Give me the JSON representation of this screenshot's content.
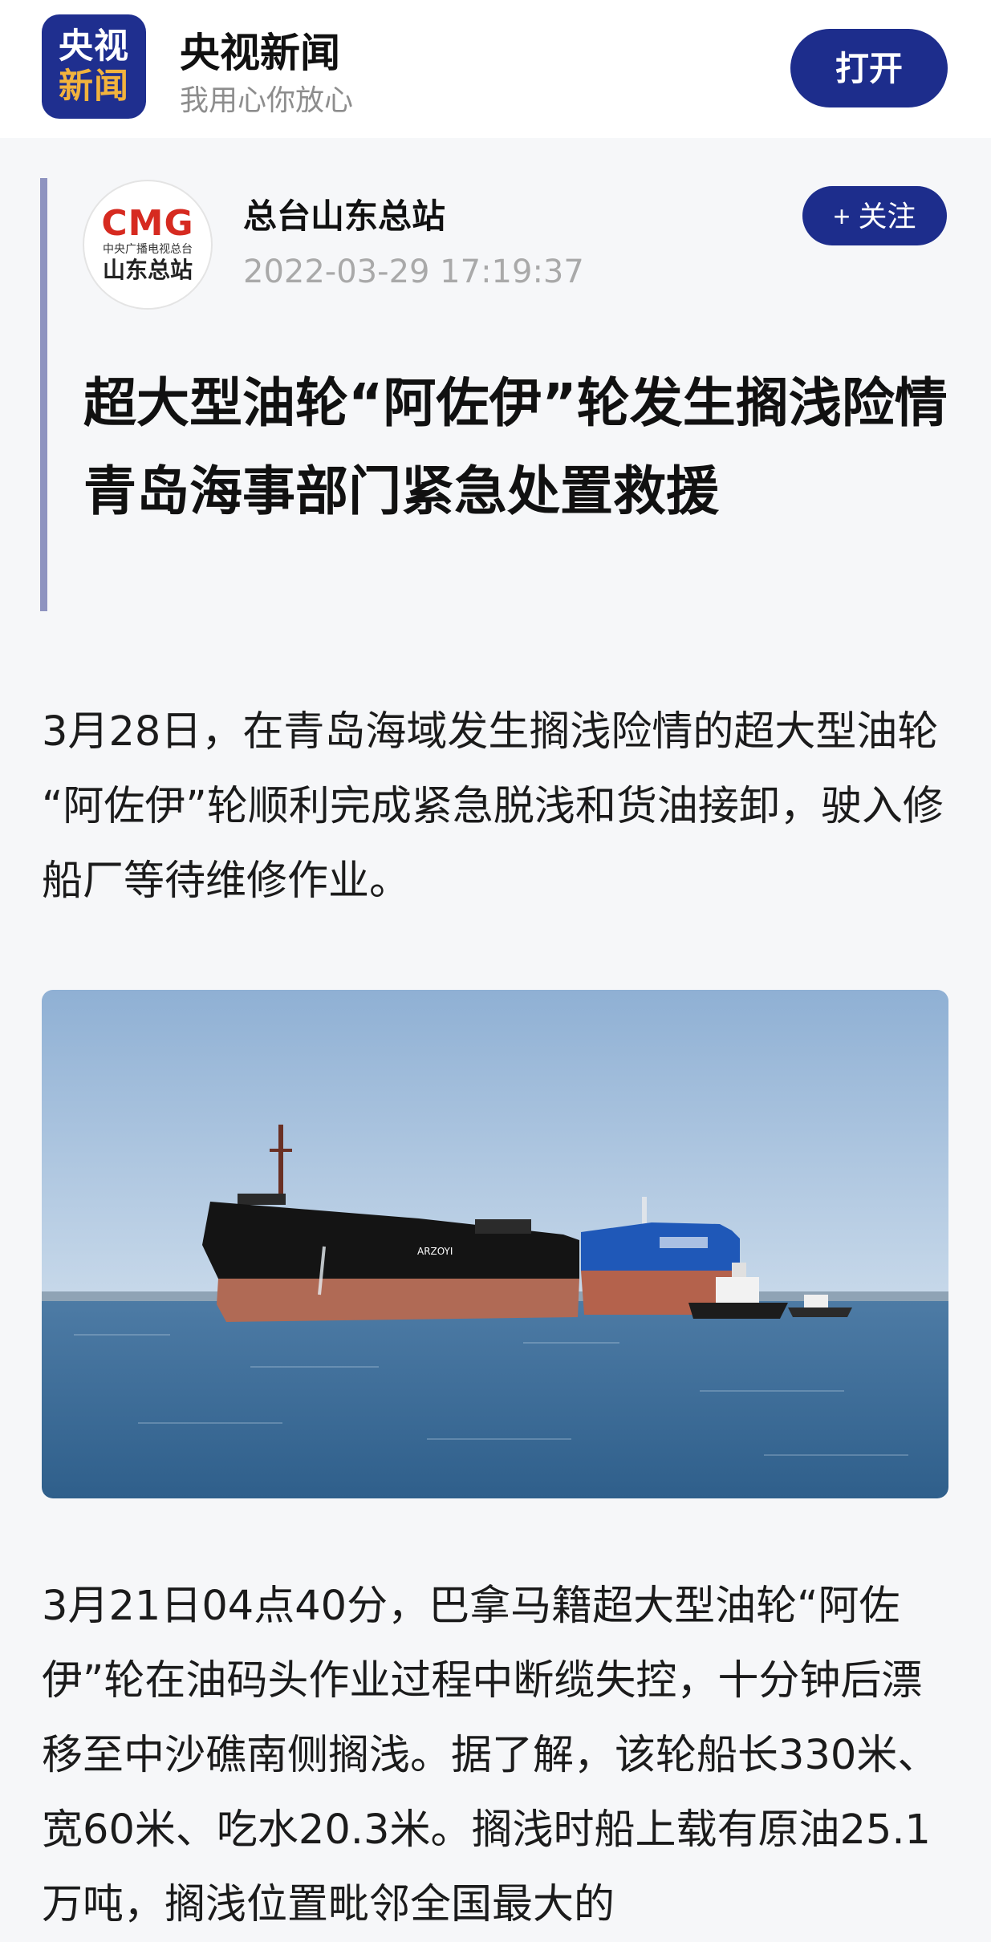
{
  "app_bar": {
    "logo_line1": "央视",
    "logo_line2": "新闻",
    "app_name": "央视新闻",
    "slogan": "我用心你放心",
    "open_button": "打开"
  },
  "source": {
    "avatar_brand": "CMG",
    "avatar_subtitle": "中央广播电视总台",
    "avatar_station": "山东总站",
    "name": "总台山东总站",
    "publish_time": "2022-03-29 17:19:37",
    "follow_button": "+ 关注"
  },
  "article": {
    "title": "超大型油轮“阿佐伊”轮发生搁浅险情 青岛海事部门紧急处置救援",
    "paragraph1": "3月28日，在青岛海域发生搁浅险情的超大型油轮 “阿佐伊”轮顺利完成紧急脱浅和货油接卸，驶入修船厂等待维修作业。",
    "photo": {
      "description_icon": "ship-photo",
      "hull_text": "ARZOYI",
      "colors": {
        "sky": "#9db9d9",
        "sea": "#3e6e99",
        "tanker_black": "#141414",
        "hull_red": "#b06a55",
        "tanker_blue": "#1f58b8"
      }
    },
    "paragraph2": "3月21日04点40分，巴拿马籍超大型油轮“阿佐伊”轮在油码头作业过程中断缆失控，十分钟后漂移至中沙礁南侧搁浅。据了解，该轮船长330米、宽60米、吃水20.3米。搁浅时船上载有原油25.1万吨，搁浅位置毗邻全国最大的"
  },
  "colors": {
    "brand_blue": "#1d2d8c",
    "accent_bar": "#8e93c0",
    "logo_gold": "#f2b33d",
    "cmg_red": "#d62a20"
  }
}
